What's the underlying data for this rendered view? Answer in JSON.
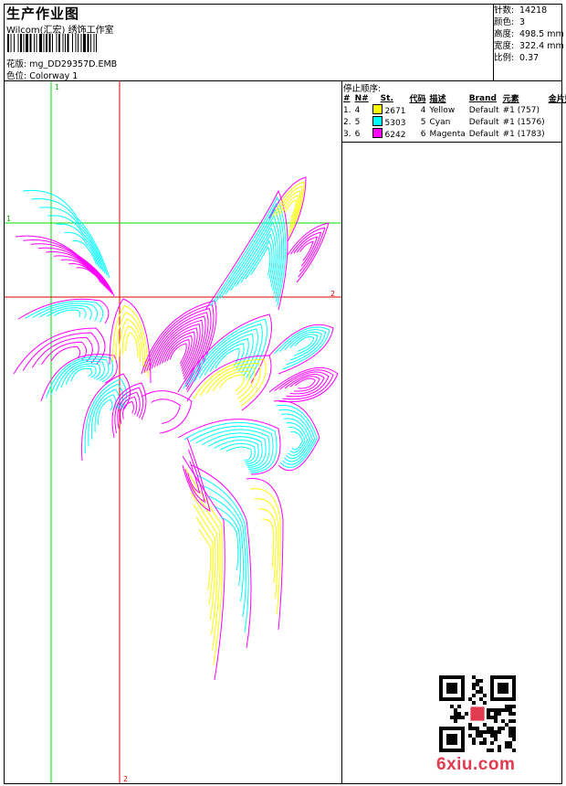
{
  "header": {
    "title": "生产作业图",
    "company": "Wilcom(汇宏) 绣饰工作室",
    "design_label": "花版:",
    "design_value": "mg_DD29357D.EMB",
    "colorway_label": "色位:",
    "colorway_value": "Colorway 1"
  },
  "stats": {
    "stitches_label": "针数:",
    "stitches_value": "14218",
    "colors_label": "颜色:",
    "colors_value": "3",
    "height_label": "高度:",
    "height_value": "498.5 mm",
    "width_label": "宽度:",
    "width_value": "322.4 mm",
    "scale_label": "比例:",
    "scale_value": "0.37"
  },
  "stop_sequence": {
    "title": "停止顺序:",
    "headers": [
      "#",
      "N#",
      "St.",
      "代码",
      "描述",
      "Brand",
      "元素",
      "金片数"
    ],
    "rows": [
      {
        "idx": "1.",
        "n": "4",
        "code": "2671",
        "num": "4",
        "desc": "Yellow",
        "brand": "Default",
        "element": "#1 (757)",
        "color": "#ffff00"
      },
      {
        "idx": "2.",
        "n": "5",
        "code": "5303",
        "num": "5",
        "desc": "Cyan",
        "brand": "Default",
        "element": "#1 (1576)",
        "color": "#00ffff"
      },
      {
        "idx": "3.",
        "n": "6",
        "code": "6242",
        "num": "6",
        "desc": "Magenta",
        "brand": "Default",
        "element": "#1 (1783)",
        "color": "#ff00ff"
      }
    ]
  },
  "guides": {
    "v1_label": "1",
    "v2_label": "2",
    "h1_label": "1",
    "h2_label": "2",
    "v1_color": "#00dd00",
    "v2_color": "#dd0000"
  },
  "watermark": "6xiu.com",
  "colors": {
    "yellow": "#ffff00",
    "cyan": "#00ffff",
    "magenta": "#ff00ff"
  }
}
